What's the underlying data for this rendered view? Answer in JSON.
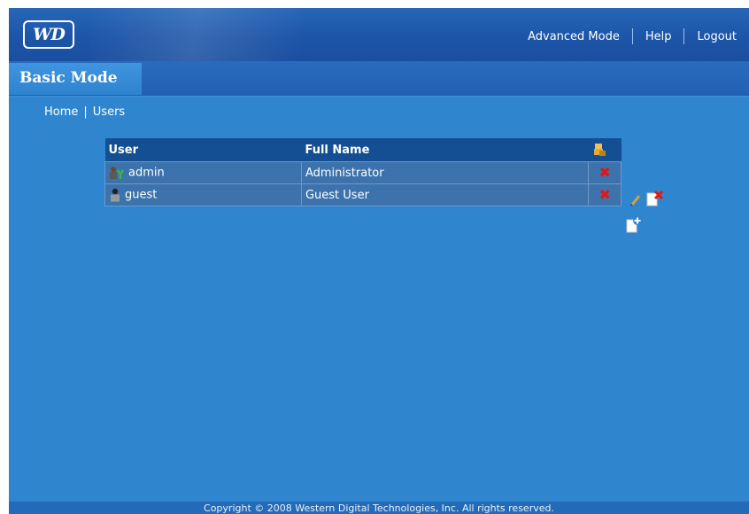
{
  "logo": {
    "text": "WD"
  },
  "topnav": {
    "advanced_mode": "Advanced Mode",
    "help": "Help",
    "logout": "Logout"
  },
  "tabs": {
    "basic_mode": "Basic Mode"
  },
  "breadcrumb": {
    "home": "Home",
    "separator": "|",
    "current": "Users"
  },
  "table": {
    "headers": {
      "user": "User",
      "full_name": "Full Name",
      "action_icon": "user-edit-icon"
    },
    "rows": [
      {
        "user": "admin",
        "full_name": "Administrator",
        "icon": "admin-user-icon",
        "delete_icon": "delete-x-icon"
      },
      {
        "user": "guest",
        "full_name": "Guest User",
        "icon": "guest-user-icon",
        "delete_icon": "delete-x-icon"
      }
    ]
  },
  "side_actions": [
    "edit-user-icon",
    "delete-user-icon",
    "add-user-icon"
  ],
  "footer": {
    "copyright": "Copyright © 2008 Western Digital Technologies, Inc. All rights reserved."
  },
  "colors": {
    "background": "#2f86cf",
    "header": "#1d55a8",
    "table_header": "#144f93",
    "delete": "#e01818"
  }
}
